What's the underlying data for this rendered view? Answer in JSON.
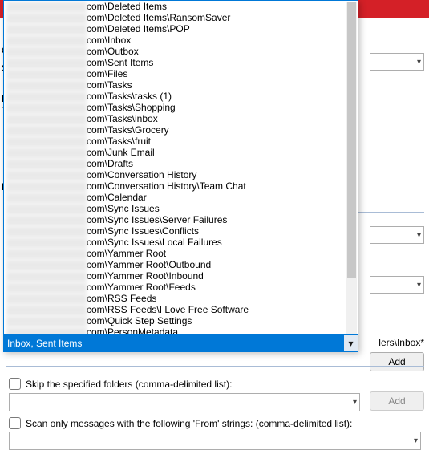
{
  "folder_list": [
    "com\\Deleted Items",
    "com\\Deleted Items\\RansomSaver",
    "com\\Deleted Items\\POP",
    "com\\Inbox",
    "com\\Outbox",
    "com\\Sent Items",
    "com\\Files",
    "com\\Tasks",
    "com\\Tasks\\tasks (1)",
    "com\\Tasks\\Shopping",
    "com\\Tasks\\inbox",
    "com\\Tasks\\Grocery",
    "com\\Tasks\\fruit",
    "com\\Junk Email",
    "com\\Drafts",
    "com\\Conversation History",
    "com\\Conversation History\\Team Chat",
    "com\\Calendar",
    "com\\Sync Issues",
    "com\\Sync Issues\\Server Failures",
    "com\\Sync Issues\\Conflicts",
    "com\\Sync Issues\\Local Failures",
    "com\\Yammer Root",
    "com\\Yammer Root\\Outbound",
    "com\\Yammer Root\\Inbound",
    "com\\Yammer Root\\Feeds",
    "com\\RSS Feeds",
    "com\\RSS Feeds\\I Love Free Software",
    "com\\Quick Step Settings",
    "com\\PersonMetadata"
  ],
  "dropdown": {
    "selected_text": "Inbox, Sent Items"
  },
  "checkboxes": {
    "skip_label": "Skip the specified folders (comma-delimited list):",
    "scan_label": "Scan only messages with the following 'From' strings: (comma-delimited list):"
  },
  "buttons": {
    "add": "Add",
    "add2": "Add"
  },
  "path_hint": "lers\\Inbox*",
  "left_cut_letters": {
    "C": "C",
    "S": "S",
    "F": "F",
    "T": "T",
    "F2": "F"
  }
}
